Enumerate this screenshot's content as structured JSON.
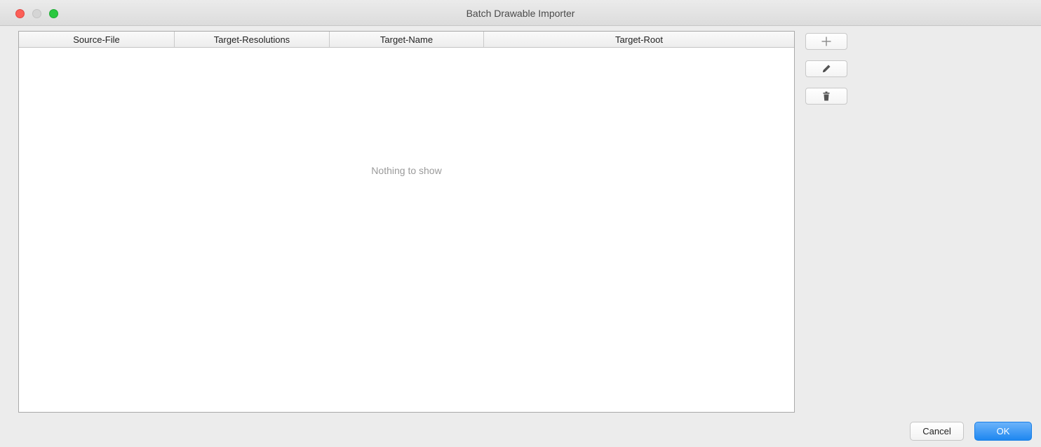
{
  "window": {
    "title": "Batch Drawable Importer"
  },
  "table": {
    "columns": [
      "Source-File",
      "Target-Resolutions",
      "Target-Name",
      "Target-Root"
    ],
    "empty_text": "Nothing to show"
  },
  "side_buttons": {
    "add_icon": "plus-icon",
    "edit_icon": "pencil-icon",
    "remove_icon": "trash-icon"
  },
  "footer": {
    "cancel_label": "Cancel",
    "ok_label": "OK"
  },
  "colors": {
    "accent": "#1e87f0",
    "close": "#fc5f57",
    "zoom": "#2ac840"
  }
}
